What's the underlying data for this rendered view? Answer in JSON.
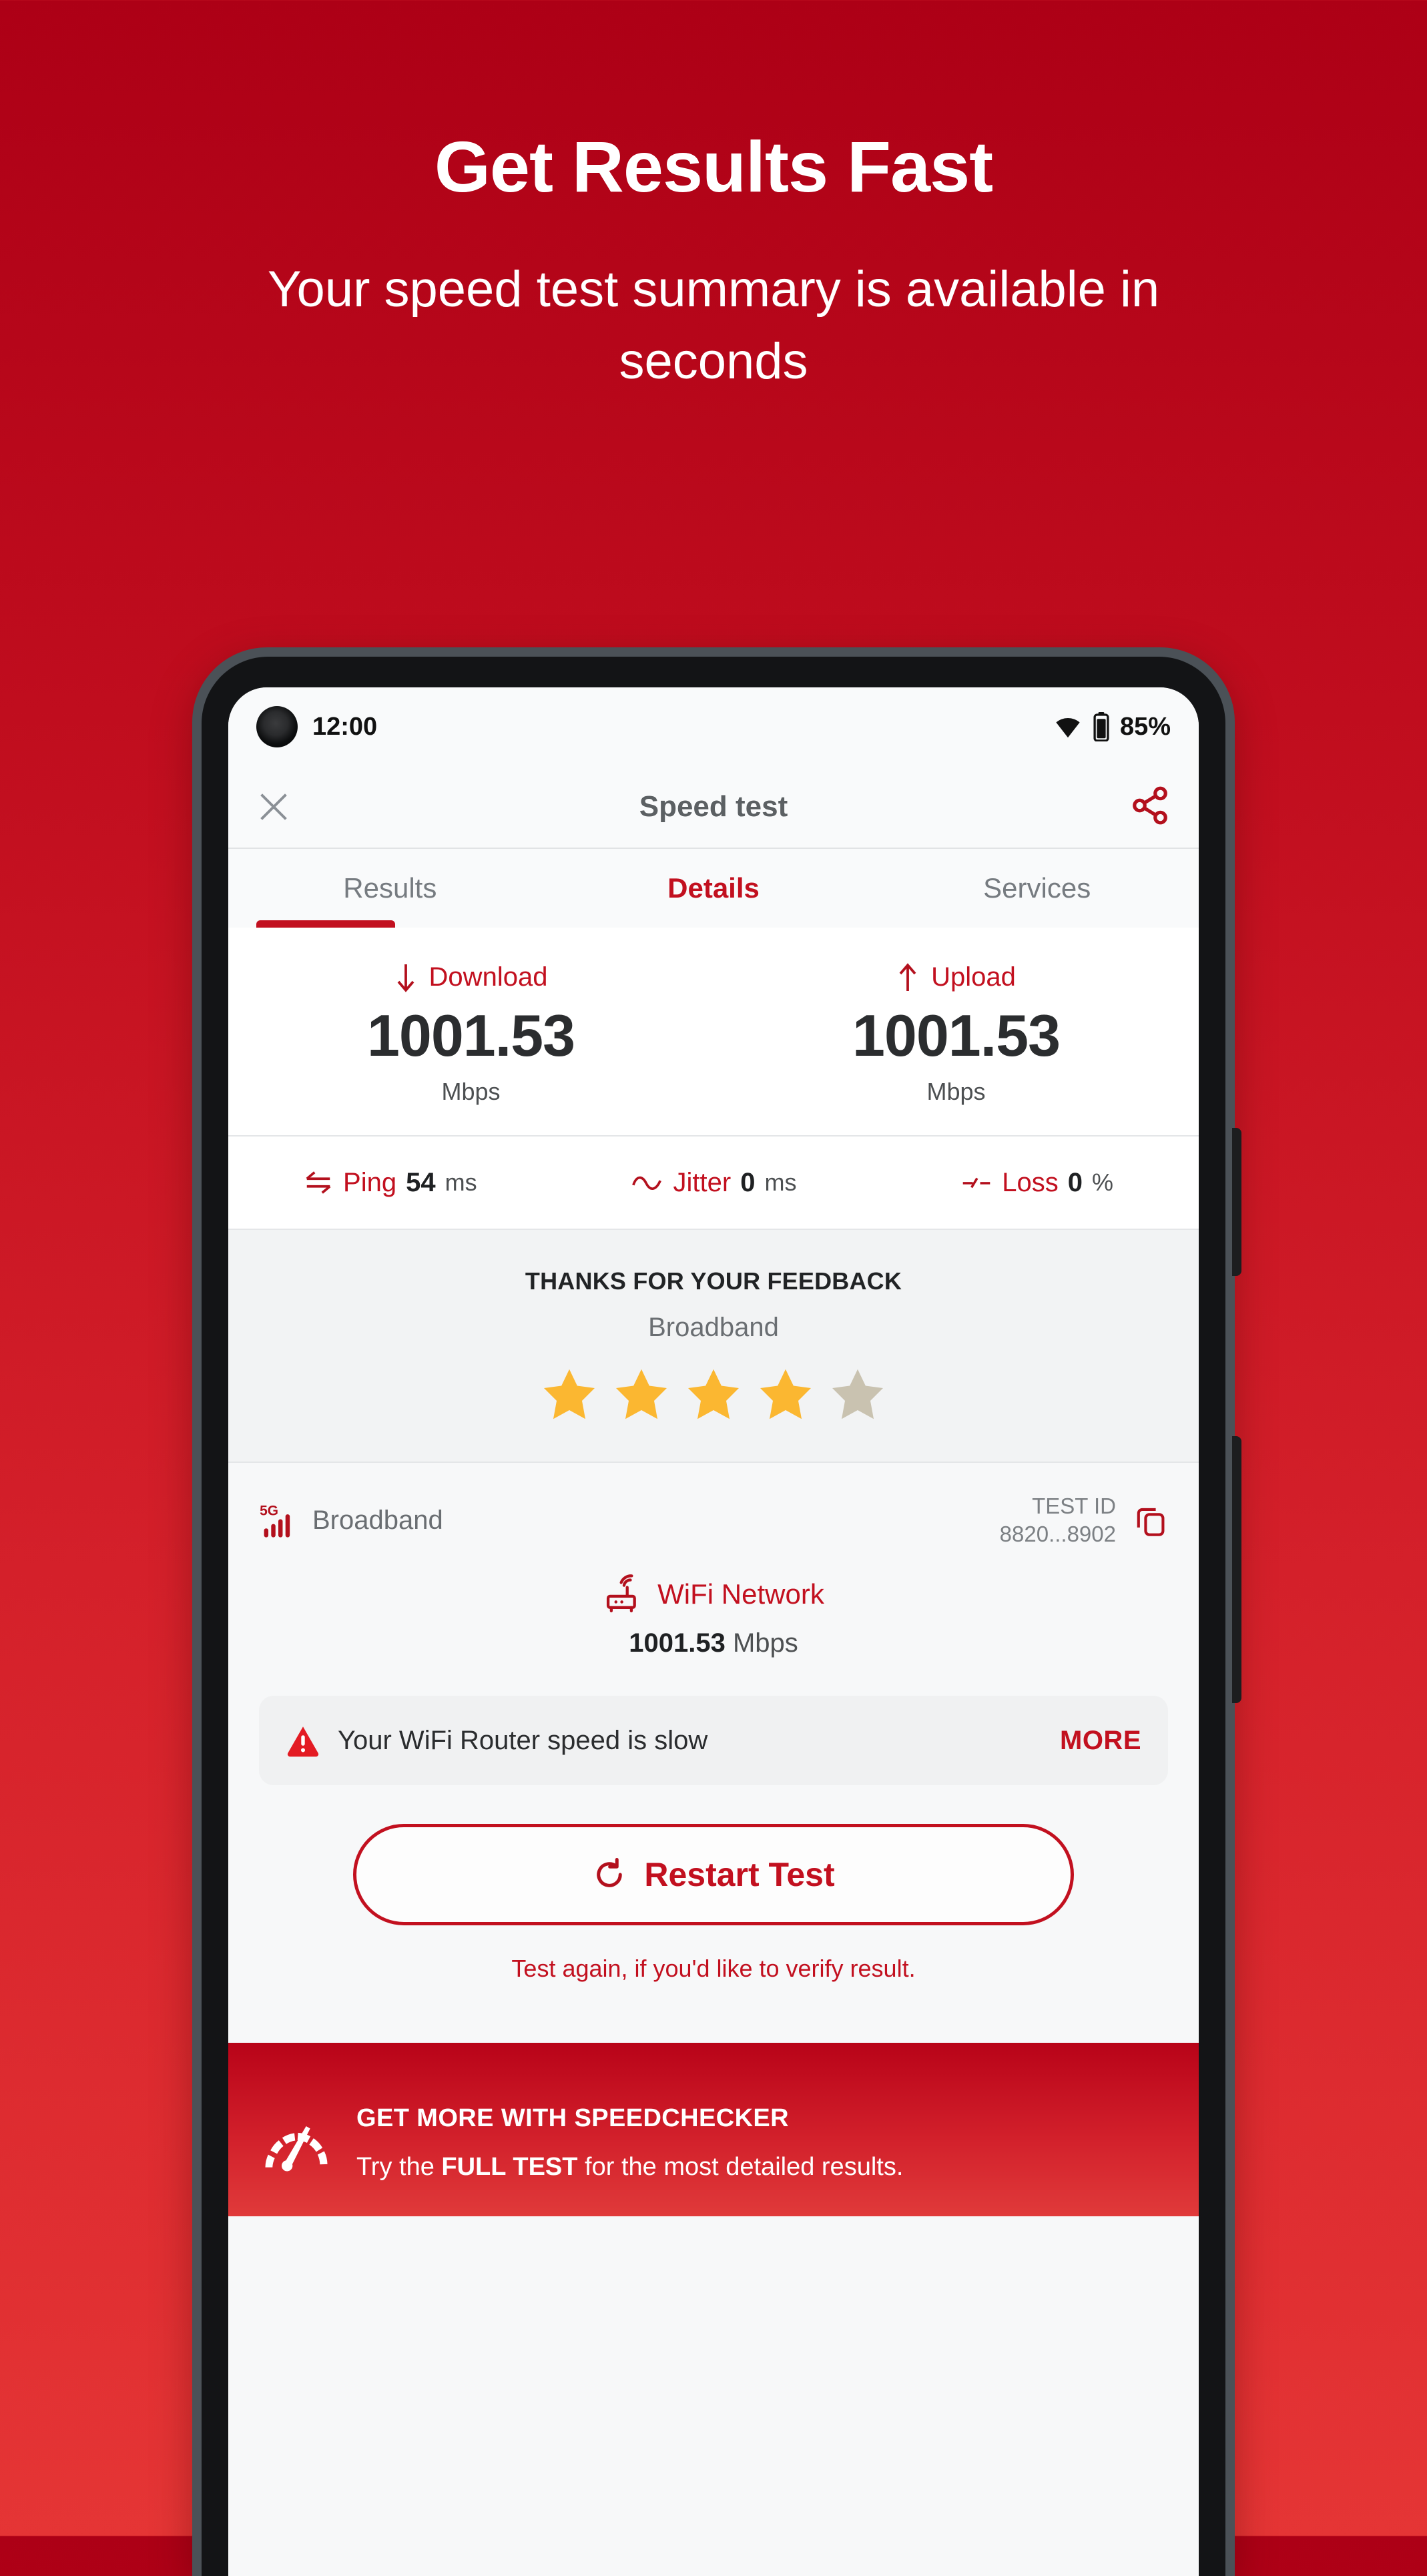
{
  "hero": {
    "title": "Get Results Fast",
    "subtitle": "Your speed test summary is available in seconds"
  },
  "colors": {
    "brand_red": "#c2101f",
    "bg_top": "#ad0016",
    "bg_bottom": "#e53535",
    "star_filled": "#fbb731",
    "star_empty": "#c9c2b0"
  },
  "status_bar": {
    "time": "12:00",
    "battery": "85%",
    "wifi_icon": "wifi-icon",
    "battery_icon": "battery-icon",
    "camera_icon": "front-camera-punchhole"
  },
  "app_bar": {
    "close_icon": "close-icon",
    "title": "Speed test",
    "share_icon": "share-icon"
  },
  "tabs": {
    "items": [
      {
        "label": "Results",
        "active_indicator": true
      },
      {
        "label": "Details",
        "accent": true
      },
      {
        "label": "Services",
        "accent": false
      }
    ]
  },
  "speeds": [
    {
      "icon": "download-arrow-icon",
      "label": "Download",
      "value": "1001.53",
      "unit": "Mbps"
    },
    {
      "icon": "upload-arrow-icon",
      "label": "Upload",
      "value": "1001.53",
      "unit": "Mbps"
    }
  ],
  "metrics": [
    {
      "icon": "ping-icon",
      "label": "Ping",
      "value": "54",
      "unit": "ms"
    },
    {
      "icon": "jitter-icon",
      "label": "Jitter",
      "value": "0",
      "unit": "ms"
    },
    {
      "icon": "loss-icon",
      "label": "Loss",
      "value": "0",
      "unit": "%"
    }
  ],
  "feedback": {
    "title": "THANKS FOR YOUR FEEDBACK",
    "subtitle": "Broadband",
    "rating": 4,
    "max_rating": 5
  },
  "network": {
    "signal_icon": "5g-signal-icon",
    "signal_label": "5G",
    "name": "Broadband",
    "test_id_label": "TEST ID",
    "test_id_value": "8820...8902",
    "copy_icon": "copy-icon"
  },
  "wifi": {
    "icon": "router-icon",
    "label": "WiFi Network",
    "speed": "1001.53",
    "unit": "Mbps"
  },
  "warning": {
    "icon": "warning-triangle-icon",
    "text": "Your WiFi Router speed is slow",
    "action": "MORE"
  },
  "restart": {
    "icon": "refresh-icon",
    "label": "Restart Test",
    "note": "Test again, if you'd like to verify result."
  },
  "footer": {
    "icon": "speedometer-icon",
    "title": "GET MORE WITH SPEEDCHECKER",
    "sub_prefix": "Try the ",
    "sub_bold": "FULL TEST",
    "sub_suffix": " for the most detailed results."
  }
}
